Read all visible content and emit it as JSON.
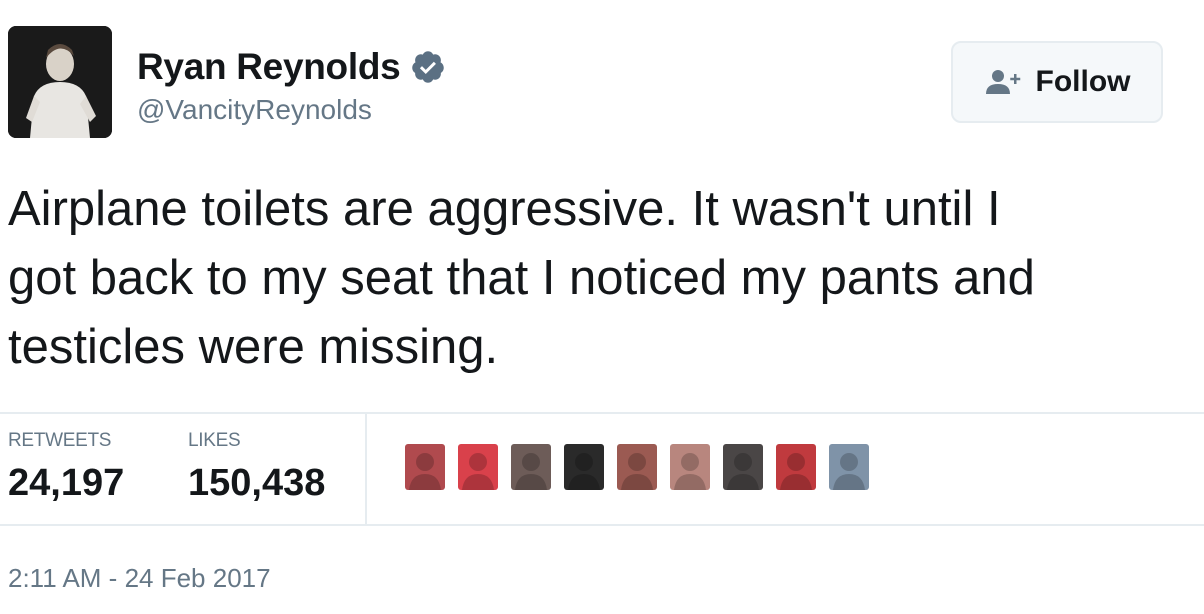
{
  "author": {
    "display_name": "Ryan Reynolds",
    "handle": "@VancityReynolds",
    "verified": true
  },
  "actions": {
    "follow_label": "Follow"
  },
  "tweet": {
    "text_lines": [
      "Airplane toilets are aggressive. It wasn't until I",
      "got back to my seat that I noticed my pants and",
      "testicles were missing."
    ],
    "timestamp": "2:11 AM - 24 Feb 2017"
  },
  "stats": {
    "retweets_label": "RETWEETS",
    "retweets_value": "24,197",
    "likes_label": "LIKES",
    "likes_value": "150,438"
  },
  "likers": [
    {
      "name": "liker-avatar-1",
      "color": "#b04a4e"
    },
    {
      "name": "liker-avatar-2",
      "color": "#d9414b"
    },
    {
      "name": "liker-avatar-3",
      "color": "#6d5c58"
    },
    {
      "name": "liker-avatar-4",
      "color": "#2a2a2a"
    },
    {
      "name": "liker-avatar-5",
      "color": "#9b5a52"
    },
    {
      "name": "liker-avatar-6",
      "color": "#b8867e"
    },
    {
      "name": "liker-avatar-7",
      "color": "#4a4646"
    },
    {
      "name": "liker-avatar-8",
      "color": "#c03a3e"
    },
    {
      "name": "liker-avatar-9",
      "color": "#7f93a8"
    }
  ],
  "colors": {
    "text_primary": "#14171a",
    "text_secondary": "#657786",
    "verified_blue": "#1da1f2",
    "divider": "#e6ecf0"
  },
  "icons": {
    "verified": "verified-badge-icon",
    "follow": "add-user-icon"
  }
}
